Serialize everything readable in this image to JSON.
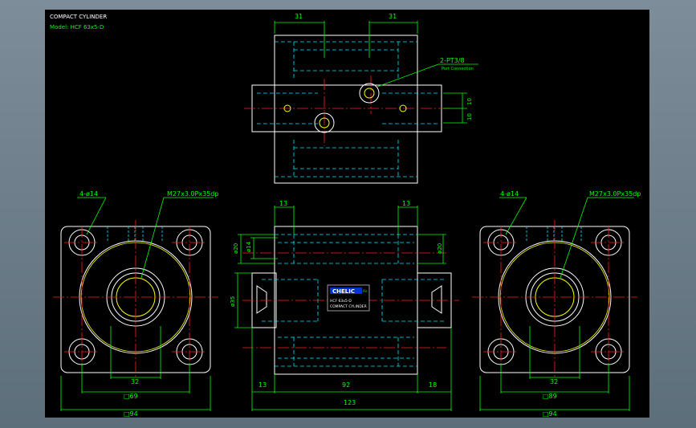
{
  "colors": {
    "background": "#000000",
    "outline": "#ffffff",
    "hidden": "#00e5ff",
    "center": "#ff2020",
    "dimension": "#00ff00",
    "thread": "#ffff00",
    "label": "#0033cc"
  },
  "title_block": {
    "title": "COMPACT CYLINDER",
    "model": "Model: HCF 63x5-D"
  },
  "top_view": {
    "dims": {
      "left_width": "31",
      "right_width": "31",
      "offset_a": "10",
      "offset_b": "10"
    },
    "port_note": {
      "label": "2-PT3/8",
      "sub": "Port Connection"
    }
  },
  "side_view_left": {
    "holes_note": "4-ø14",
    "thread_note": "M27x3.0Px35dp",
    "dim_inner": "32",
    "dim_square": "□69",
    "dim_outer": "□94"
  },
  "side_view_right": {
    "holes_note": "4-ø14",
    "thread_note": "M27x3.0Px35dp",
    "dim_inner": "32",
    "dim_square": "□89",
    "dim_outer": "□94"
  },
  "front_view": {
    "dims": {
      "top_left": "13",
      "top_right": "13",
      "dia_outer": "ø20",
      "dia_inner": "ø14",
      "dia_right": "ø20",
      "height": "ø35",
      "bottom_left": "13",
      "bottom_mid": "92",
      "bottom_right": "18",
      "overall": "123"
    },
    "nameplate": {
      "brand": "CHELIC",
      "tag": "Air",
      "model": "HCF 63x5-D",
      "product": "COMPACT CYLINDER"
    }
  }
}
